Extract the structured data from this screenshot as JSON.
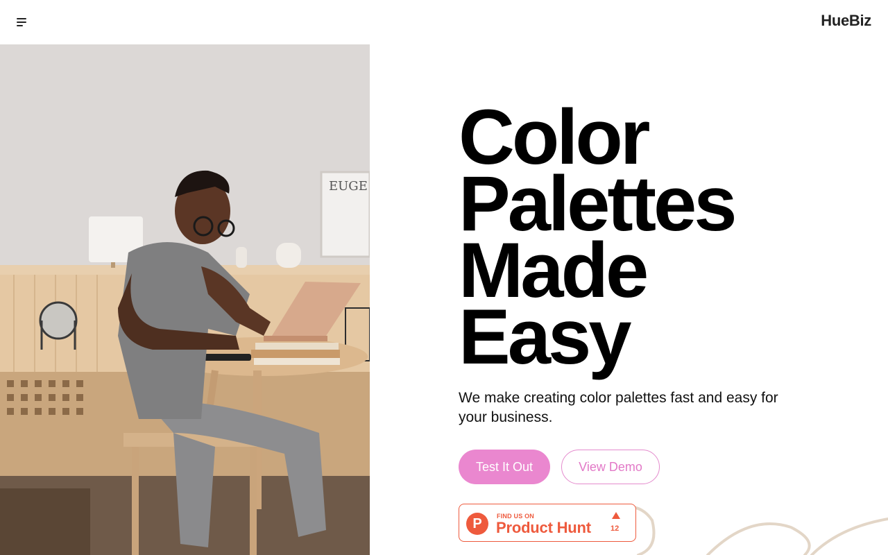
{
  "header": {
    "brand": "HueBiz",
    "menu_icon": "menu-icon"
  },
  "hero": {
    "headline_lines": [
      "Color",
      "Palettes",
      "Made",
      "Easy"
    ],
    "subtitle": "We make creating color palettes fast and easy for your business.",
    "primary_button": "Test It Out",
    "secondary_button": "View Demo"
  },
  "product_hunt": {
    "logo_letter": "P",
    "find_text": "FIND US ON",
    "name": "Product Hunt",
    "upvote_icon": "triangle-up-icon",
    "count": "12"
  },
  "colors": {
    "accent_pink": "#ea87cf",
    "product_hunt_orange": "#ee5a3d",
    "squiggle_beige": "#e3d6c7"
  }
}
